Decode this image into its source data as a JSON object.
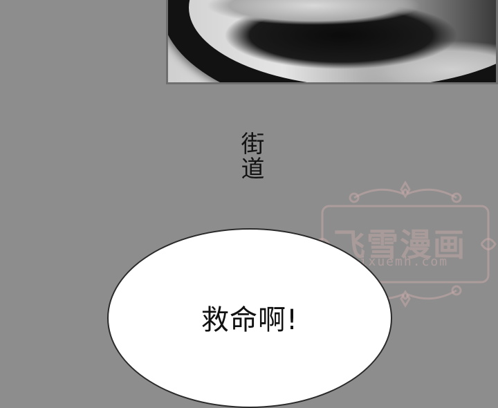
{
  "caption": {
    "text": "街道"
  },
  "speech_bubble": {
    "text": "救命啊!"
  },
  "watermark": {
    "title": "飞雪漫画",
    "url": "feixuemh.com"
  },
  "colors": {
    "background": "#8d8d8d",
    "bubble_fill": "#ffffff",
    "text": "#111111",
    "watermark": "#c8aaaa"
  }
}
